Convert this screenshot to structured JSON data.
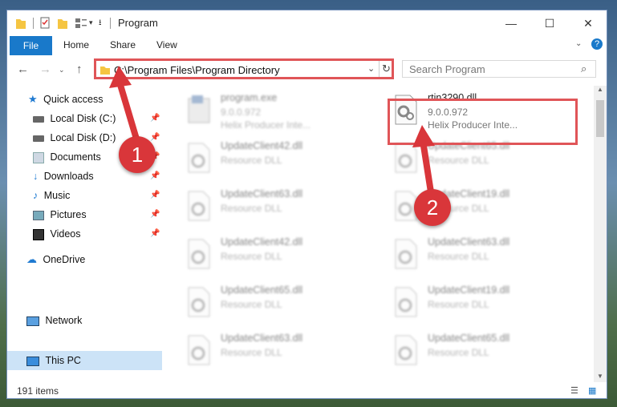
{
  "window": {
    "title": "Program"
  },
  "ribbon": {
    "tabs": [
      "File",
      "Home",
      "Share",
      "View"
    ]
  },
  "address": {
    "path": "C:\\Program Files\\Program Directory",
    "search_placeholder": "Search Program"
  },
  "sidebar": {
    "items": [
      {
        "label": "Quick access",
        "icon": "star-icon"
      },
      {
        "label": "Local Disk (C:)",
        "icon": "drive-icon",
        "pinned": true
      },
      {
        "label": "Local Disk (D:)",
        "icon": "drive-icon",
        "pinned": true
      },
      {
        "label": "Documents",
        "icon": "documents-icon",
        "pinned": true
      },
      {
        "label": "Downloads",
        "icon": "download-icon",
        "pinned": true
      },
      {
        "label": "Music",
        "icon": "music-icon",
        "pinned": true
      },
      {
        "label": "Pictures",
        "icon": "pictures-icon",
        "pinned": true
      },
      {
        "label": "Videos",
        "icon": "videos-icon",
        "pinned": true
      },
      {
        "label": "OneDrive",
        "icon": "cloud-icon"
      },
      {
        "label": "This PC",
        "icon": "computer-icon",
        "selected": true
      },
      {
        "label": "Network",
        "icon": "network-icon"
      }
    ]
  },
  "files": [
    {
      "name": "program.exe",
      "line2": "9.0.0.972",
      "line3": "Helix Producer Inte...",
      "blurred": true
    },
    {
      "name": "rtin3290.dll",
      "line2": "9.0.0.972",
      "line3": "Helix Producer Inte...",
      "blurred": false
    },
    {
      "name": "UpdateClient42.dll",
      "line2": "Resource DLL",
      "blurred": true
    },
    {
      "name": "UpdateClient65.dll",
      "line2": "Resource DLL",
      "blurred": true
    },
    {
      "name": "UpdateClient63.dll",
      "line2": "Resource DLL",
      "blurred": true
    },
    {
      "name": "UpdateClient19.dll",
      "line2": "Resource DLL",
      "blurred": true
    },
    {
      "name": "UpdateClient42.dll",
      "line2": "Resource DLL",
      "blurred": true
    },
    {
      "name": "UpdateClient63.dll",
      "line2": "Resource DLL",
      "blurred": true
    },
    {
      "name": "UpdateClient65.dll",
      "line2": "Resource DLL",
      "blurred": true
    },
    {
      "name": "UpdateClient19.dll",
      "line2": "Resource DLL",
      "blurred": true
    },
    {
      "name": "UpdateClient63.dll",
      "line2": "Resource DLL",
      "blurred": true
    },
    {
      "name": "UpdateClient65.dll",
      "line2": "Resource DLL",
      "blurred": true
    }
  ],
  "status": {
    "item_count": "191 items"
  },
  "annotations": {
    "badge1": "1",
    "badge2": "2"
  },
  "colors": {
    "accent": "#1979ca",
    "highlight": "#e05558",
    "badge": "#d9363a"
  }
}
